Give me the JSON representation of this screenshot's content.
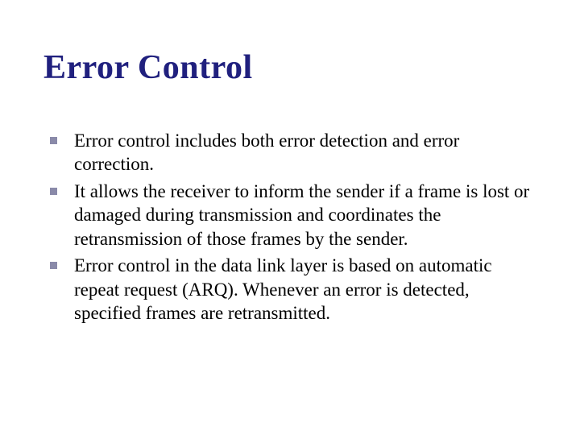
{
  "slide": {
    "title": "Error Control",
    "bullets": [
      "Error control includes both error detection and error correction.",
      "It allows the receiver to inform the sender if a frame is lost or damaged during transmission and coordinates the retransmission of those frames by the sender.",
      "Error control in the data link layer is based on automatic repeat request (ARQ). Whenever an error is detected, specified frames are retransmitted."
    ]
  }
}
